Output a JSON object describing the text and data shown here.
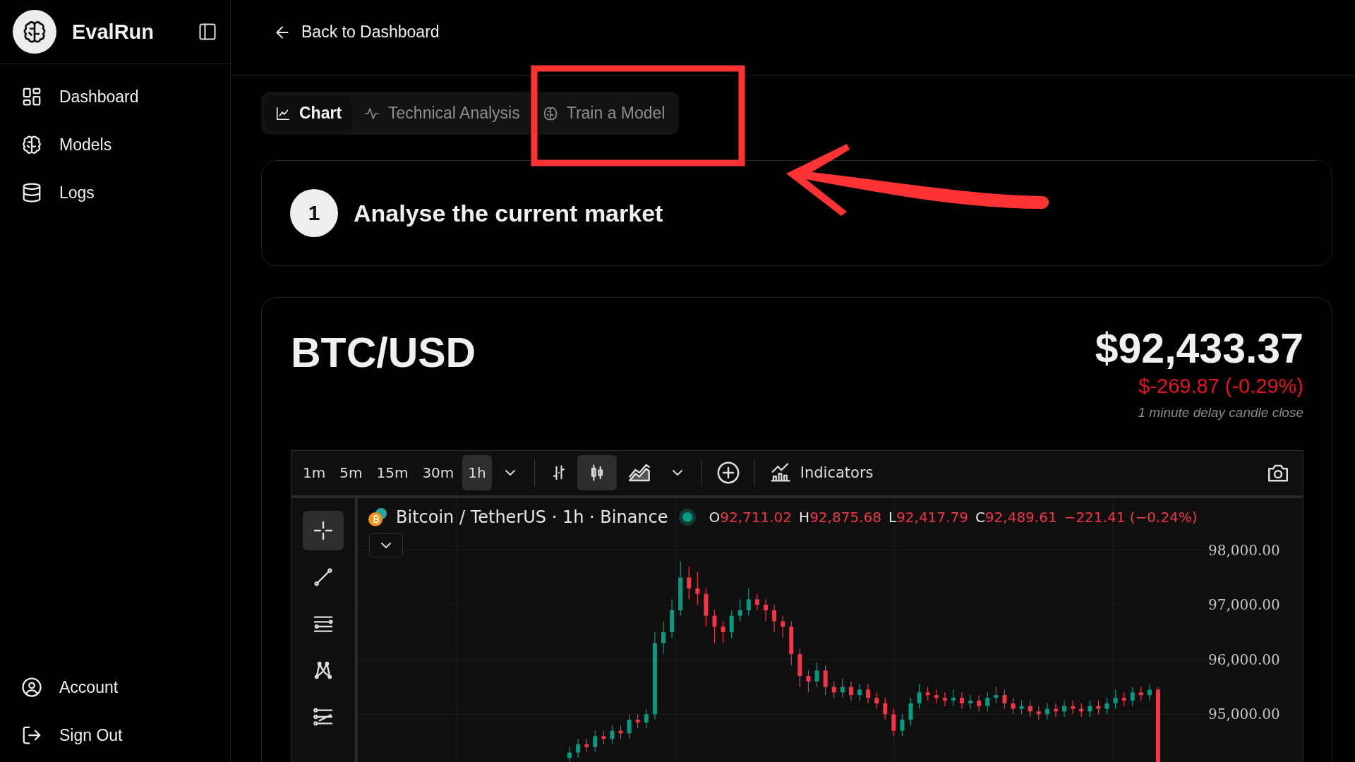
{
  "sidebar": {
    "app_name": "EvalRun",
    "nav_items": [
      {
        "kind": "grid",
        "label": "Dashboard"
      },
      {
        "kind": "brain",
        "label": "Models"
      },
      {
        "kind": "database",
        "label": "Logs"
      }
    ],
    "bottom_items": [
      {
        "kind": "user",
        "label": "Account"
      },
      {
        "kind": "logout",
        "label": "Sign Out"
      }
    ]
  },
  "header": {
    "back_link": "Back to Dashboard"
  },
  "tabs": [
    {
      "kind": "chart",
      "label": "Chart",
      "selected": true
    },
    {
      "kind": "pulse",
      "label": "Technical Analysis",
      "selected": false
    },
    {
      "kind": "brain",
      "label": "Train a Model",
      "selected": false
    }
  ],
  "step": {
    "number": "1",
    "title": "Analyse the current market"
  },
  "market": {
    "pair": "BTC/USD",
    "price": "$92,433.37",
    "change": "$-269.87 (-0.29%)",
    "note": "1 minute delay candle close"
  },
  "chart_toolbar": {
    "timeframes": [
      {
        "label": "1m",
        "selected": false
      },
      {
        "label": "5m",
        "selected": false
      },
      {
        "label": "15m",
        "selected": false
      },
      {
        "label": "30m",
        "selected": false
      },
      {
        "label": "1h",
        "selected": true
      }
    ],
    "styles": [
      {
        "kind": "bars",
        "selected": false
      },
      {
        "kind": "candles",
        "selected": true
      },
      {
        "kind": "area",
        "selected": false
      }
    ],
    "indicators": "Indicators"
  },
  "drawing_tools": [
    {
      "kind": "crosshair",
      "selected": true
    },
    {
      "kind": "trend-line",
      "selected": false
    },
    {
      "kind": "horizontal-lines",
      "selected": false
    },
    {
      "kind": "pattern",
      "selected": false
    },
    {
      "kind": "fib",
      "selected": false
    }
  ],
  "legend": {
    "symbol": "Bitcoin / TetherUS · 1h · Binance",
    "ohlc": [
      {
        "label": "O",
        "value": "92,711.02"
      },
      {
        "label": "H",
        "value": "92,875.68"
      },
      {
        "label": "L",
        "value": "92,417.79"
      },
      {
        "label": "C",
        "value": "92,489.61"
      }
    ],
    "change": "−221.41 (−0.24%)"
  },
  "chart_data": {
    "type": "candlestick",
    "ohlc": [
      [
        94200,
        94400,
        94100,
        94300
      ],
      [
        94300,
        94550,
        94200,
        94450
      ],
      [
        94450,
        94550,
        94300,
        94400
      ],
      [
        94400,
        94700,
        94300,
        94600
      ],
      [
        94600,
        94700,
        94450,
        94550
      ],
      [
        94550,
        94800,
        94450,
        94700
      ],
      [
        94700,
        94800,
        94550,
        94650
      ],
      [
        94650,
        95000,
        94550,
        94900
      ],
      [
        94900,
        95000,
        94750,
        94850
      ],
      [
        94850,
        95100,
        94750,
        95000
      ],
      [
        95000,
        96500,
        94900,
        96300
      ],
      [
        96300,
        96700,
        96100,
        96500
      ],
      [
        96500,
        97100,
        96400,
        96900
      ],
      [
        96900,
        97800,
        96800,
        97500
      ],
      [
        97500,
        97700,
        97100,
        97300
      ],
      [
        97300,
        97600,
        97000,
        97200
      ],
      [
        97200,
        97300,
        96600,
        96800
      ],
      [
        96800,
        96900,
        96300,
        96600
      ],
      [
        96600,
        96700,
        96300,
        96500
      ],
      [
        96500,
        96900,
        96400,
        96800
      ],
      [
        96800,
        97100,
        96700,
        96900
      ],
      [
        96900,
        97300,
        96800,
        97100
      ],
      [
        97100,
        97200,
        96900,
        97000
      ],
      [
        97000,
        97100,
        96700,
        96900
      ],
      [
        96900,
        97000,
        96500,
        96700
      ],
      [
        96700,
        96800,
        96400,
        96600
      ],
      [
        96600,
        96700,
        95900,
        96100
      ],
      [
        96100,
        96200,
        95500,
        95700
      ],
      [
        95700,
        95800,
        95400,
        95600
      ],
      [
        95600,
        95950,
        95500,
        95800
      ],
      [
        95800,
        95900,
        95350,
        95500
      ],
      [
        95500,
        95600,
        95300,
        95400
      ],
      [
        95400,
        95650,
        95300,
        95500
      ],
      [
        95500,
        95600,
        95250,
        95350
      ],
      [
        95350,
        95550,
        95250,
        95450
      ],
      [
        95450,
        95550,
        95200,
        95300
      ],
      [
        95300,
        95400,
        95100,
        95200
      ],
      [
        95200,
        95300,
        94900,
        95000
      ],
      [
        95000,
        95100,
        94600,
        94700
      ],
      [
        94700,
        95000,
        94600,
        94900
      ],
      [
        94900,
        95300,
        94800,
        95200
      ],
      [
        95200,
        95550,
        95100,
        95400
      ],
      [
        95400,
        95500,
        95250,
        95350
      ],
      [
        95350,
        95450,
        95200,
        95300
      ],
      [
        95300,
        95400,
        95150,
        95250
      ],
      [
        95250,
        95450,
        95150,
        95300
      ],
      [
        95300,
        95400,
        95100,
        95200
      ],
      [
        95200,
        95350,
        95100,
        95250
      ],
      [
        95250,
        95350,
        95050,
        95150
      ],
      [
        95150,
        95400,
        95050,
        95300
      ],
      [
        95300,
        95500,
        95200,
        95350
      ],
      [
        95350,
        95450,
        95100,
        95200
      ],
      [
        95200,
        95300,
        95000,
        95100
      ],
      [
        95100,
        95250,
        95000,
        95150
      ],
      [
        95150,
        95250,
        94950,
        95050
      ],
      [
        95050,
        95150,
        94900,
        95000
      ],
      [
        95000,
        95200,
        94900,
        95100
      ],
      [
        95100,
        95200,
        94950,
        95050
      ],
      [
        95050,
        95250,
        94950,
        95150
      ],
      [
        95150,
        95250,
        95000,
        95100
      ],
      [
        95100,
        95200,
        94950,
        95050
      ],
      [
        95050,
        95250,
        94950,
        95150
      ],
      [
        95150,
        95250,
        95000,
        95100
      ],
      [
        95100,
        95300,
        95000,
        95200
      ],
      [
        95200,
        95450,
        95100,
        95300
      ],
      [
        95300,
        95400,
        95150,
        95250
      ],
      [
        95250,
        95500,
        95150,
        95400
      ],
      [
        95400,
        95500,
        95250,
        95350
      ],
      [
        95350,
        95550,
        95250,
        95450
      ],
      [
        95450,
        95500,
        94070,
        94070
      ]
    ],
    "ylim": [
      94050,
      98950
    ],
    "grid": true,
    "yticks": [
      {
        "value": 98000,
        "label": "98,000.00"
      },
      {
        "value": 97000,
        "label": "97,000.00"
      },
      {
        "value": 96000,
        "label": "96,000.00"
      },
      {
        "value": 95000,
        "label": "95,000.00"
      }
    ]
  }
}
